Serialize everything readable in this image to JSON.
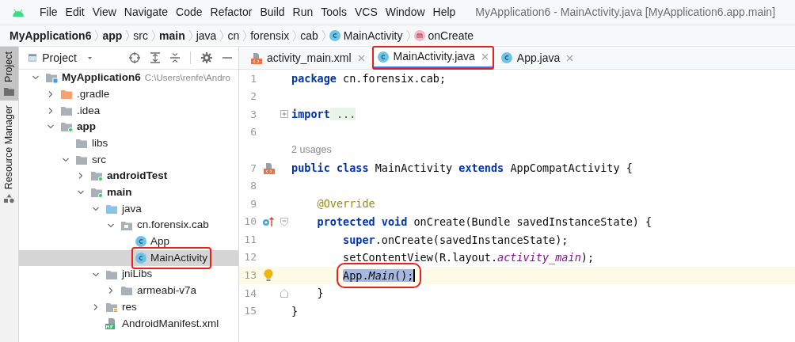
{
  "menu_bar": {
    "items": [
      "File",
      "Edit",
      "View",
      "Navigate",
      "Code",
      "Refactor",
      "Build",
      "Run",
      "Tools",
      "VCS",
      "Window",
      "Help"
    ],
    "title": "MyApplication6 - MainActivity.java [MyApplication6.app.main]"
  },
  "breadcrumb": [
    {
      "label": "MyApplication6",
      "bold": true,
      "kind": "plain"
    },
    {
      "label": "app",
      "bold": true,
      "kind": "plain"
    },
    {
      "label": "src",
      "bold": false,
      "kind": "plain"
    },
    {
      "label": "main",
      "bold": true,
      "kind": "plain"
    },
    {
      "label": "java",
      "bold": false,
      "kind": "plain"
    },
    {
      "label": "cn",
      "bold": false,
      "kind": "plain"
    },
    {
      "label": "forensix",
      "bold": false,
      "kind": "plain"
    },
    {
      "label": "cab",
      "bold": false,
      "kind": "plain"
    },
    {
      "label": "MainActivity",
      "bold": false,
      "kind": "class"
    },
    {
      "label": "onCreate",
      "bold": false,
      "kind": "method"
    }
  ],
  "side_strip": [
    {
      "label": "Project",
      "selected": true
    },
    {
      "label": "Resource Manager",
      "selected": false
    }
  ],
  "project_panel": {
    "title": "Project",
    "tree": [
      {
        "label": "MyApplication6",
        "path": "C:\\Users\\renfe\\Andro",
        "kind": "module",
        "bold": true,
        "expanded": true,
        "selected": false,
        "children": [
          {
            "label": ".gradle",
            "kind": "folder-orange",
            "bold": false,
            "expanded": false,
            "selected": false
          },
          {
            "label": ".idea",
            "kind": "folder",
            "bold": false,
            "expanded": false,
            "selected": false
          },
          {
            "label": "app",
            "kind": "module-folder",
            "bold": true,
            "expanded": true,
            "selected": false,
            "children": [
              {
                "label": "libs",
                "kind": "folder",
                "bold": false,
                "selected": false
              },
              {
                "label": "src",
                "kind": "folder",
                "bold": false,
                "expanded": true,
                "selected": false,
                "children": [
                  {
                    "label": "androidTest",
                    "kind": "module-folder",
                    "bold": true,
                    "expanded": false,
                    "selected": false
                  },
                  {
                    "label": "main",
                    "kind": "module-folder",
                    "bold": true,
                    "expanded": true,
                    "selected": false,
                    "children": [
                      {
                        "label": "java",
                        "kind": "folder-source",
                        "bold": false,
                        "expanded": true,
                        "selected": false,
                        "children": [
                          {
                            "label": "cn.forensix.cab",
                            "kind": "package",
                            "bold": false,
                            "expanded": true,
                            "selected": false,
                            "children": [
                              {
                                "label": "App",
                                "kind": "class",
                                "bold": false,
                                "selected": false
                              },
                              {
                                "label": "MainActivity",
                                "kind": "class",
                                "bold": false,
                                "selected": true,
                                "outlined": true
                              }
                            ]
                          }
                        ]
                      },
                      {
                        "label": "jniLibs",
                        "kind": "folder",
                        "bold": false,
                        "expanded": true,
                        "selected": false,
                        "children": [
                          {
                            "label": "armeabi-v7a",
                            "kind": "folder",
                            "bold": false,
                            "expanded": false,
                            "selected": false
                          }
                        ]
                      },
                      {
                        "label": "res",
                        "kind": "folder-res",
                        "bold": false,
                        "expanded": false,
                        "selected": false
                      },
                      {
                        "label": "AndroidManifest.xml",
                        "kind": "manifest",
                        "bold": false,
                        "selected": false
                      }
                    ]
                  }
                ]
              }
            ]
          }
        ]
      }
    ]
  },
  "editor": {
    "tabs": [
      {
        "label": "activity_main.xml",
        "kind": "xml",
        "selected": false,
        "outlined": false
      },
      {
        "label": "MainActivity.java",
        "kind": "class",
        "selected": true,
        "outlined": true
      },
      {
        "label": "App.java",
        "kind": "class",
        "selected": false,
        "outlined": false
      }
    ],
    "lines": [
      {
        "number": "1",
        "kind": "top",
        "tokens": [
          {
            "text": "package",
            "kind": "keyword"
          },
          {
            "text": " cn.forensix.cab;",
            "kind": "plain"
          }
        ]
      },
      {
        "number": "2",
        "kind": "blank"
      },
      {
        "number": "3",
        "kind": "top",
        "markers": [
          {
            "kind": "fold-expand"
          }
        ],
        "tokens": [
          {
            "text": "import",
            "kind": "keyword"
          },
          {
            "text": " ...",
            "kind": "folded"
          }
        ]
      },
      {
        "number": "6",
        "kind": "blank"
      },
      {
        "kind": "hint",
        "text": "2 usages"
      },
      {
        "number": "7",
        "kind": "top",
        "markers": [
          {
            "kind": "xml"
          }
        ],
        "tokens": [
          {
            "text": "public class",
            "kind": "keyword"
          },
          {
            "text": " MainActivity ",
            "kind": "plain"
          },
          {
            "text": "extends",
            "kind": "keyword"
          },
          {
            "text": " AppCompatActivity {",
            "kind": "plain"
          }
        ]
      },
      {
        "number": "8",
        "kind": "blank"
      },
      {
        "number": "9",
        "kind": "member",
        "tokens": [
          {
            "text": "@Override",
            "kind": "annotation"
          }
        ]
      },
      {
        "number": "10",
        "kind": "member",
        "markers": [
          {
            "kind": "override"
          },
          {
            "kind": "fold-collapse"
          }
        ],
        "tokens": [
          {
            "text": "protected void",
            "kind": "keyword"
          },
          {
            "text": " onCreate(Bundle savedInstanceState) {",
            "kind": "plain"
          }
        ]
      },
      {
        "number": "11",
        "kind": "statement",
        "tokens": [
          {
            "text": "super",
            "kind": "keyword"
          },
          {
            "text": ".onCreate(savedInstanceState);",
            "kind": "plain"
          }
        ]
      },
      {
        "number": "12",
        "kind": "statement",
        "tokens": [
          {
            "text": "setContentView(R.layout.",
            "kind": "plain"
          },
          {
            "text": "activity_main",
            "kind": "field"
          },
          {
            "text": ");",
            "kind": "plain"
          }
        ]
      },
      {
        "number": "13",
        "kind": "statement",
        "current": true,
        "outlined": true,
        "markers": [
          {
            "kind": "bulb"
          }
        ],
        "tokens": [
          {
            "text": "App.",
            "kind": "plain",
            "selected": true
          },
          {
            "text": "Main",
            "kind": "static",
            "selected": true
          },
          {
            "text": "();",
            "kind": "plain",
            "selected": true
          }
        ]
      },
      {
        "number": "14",
        "kind": "member",
        "markers": [
          {
            "kind": "fold-end"
          }
        ],
        "tokens": [
          {
            "text": "}",
            "kind": "plain"
          }
        ]
      },
      {
        "number": "15",
        "kind": "top",
        "tokens": [
          {
            "text": "}",
            "kind": "plain"
          }
        ]
      }
    ]
  }
}
